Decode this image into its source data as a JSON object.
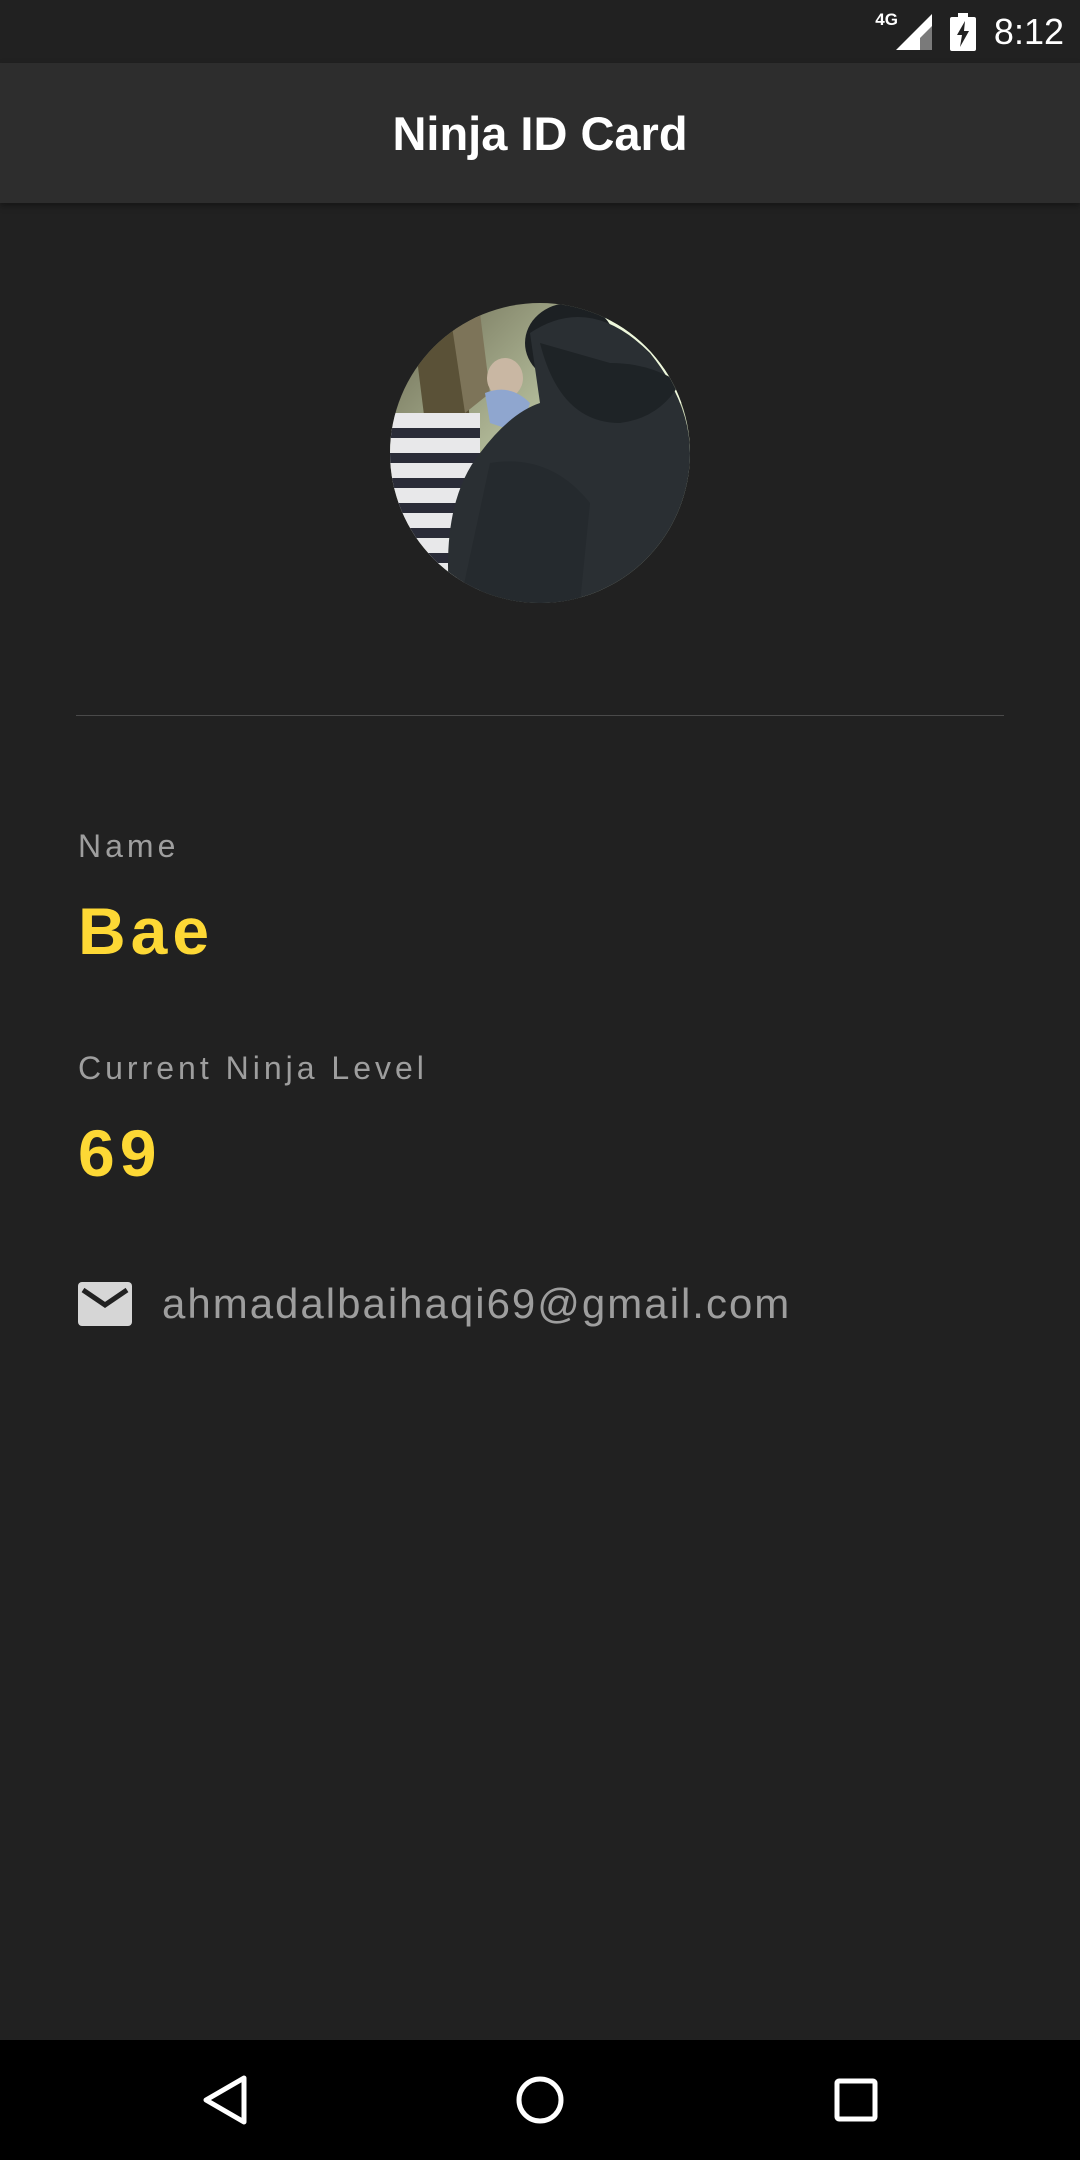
{
  "status_bar": {
    "network": "4G",
    "time": "8:12"
  },
  "app_bar": {
    "title": "Ninja ID Card"
  },
  "profile": {
    "name_label": "Name",
    "name_value": "Bae",
    "level_label": "Current Ninja Level",
    "level_value": "69",
    "email": "ahmadalbaihaqi69@gmail.com"
  },
  "colors": {
    "background": "#212121",
    "app_bar": "#2d2d2d",
    "accent": "#fdd835",
    "label": "#9e9e9e"
  },
  "icons": {
    "signal": "cell-signal-icon",
    "battery": "battery-charging-icon",
    "mail": "mail-icon",
    "back": "back-triangle-icon",
    "home": "home-circle-icon",
    "recent": "recent-square-icon"
  }
}
